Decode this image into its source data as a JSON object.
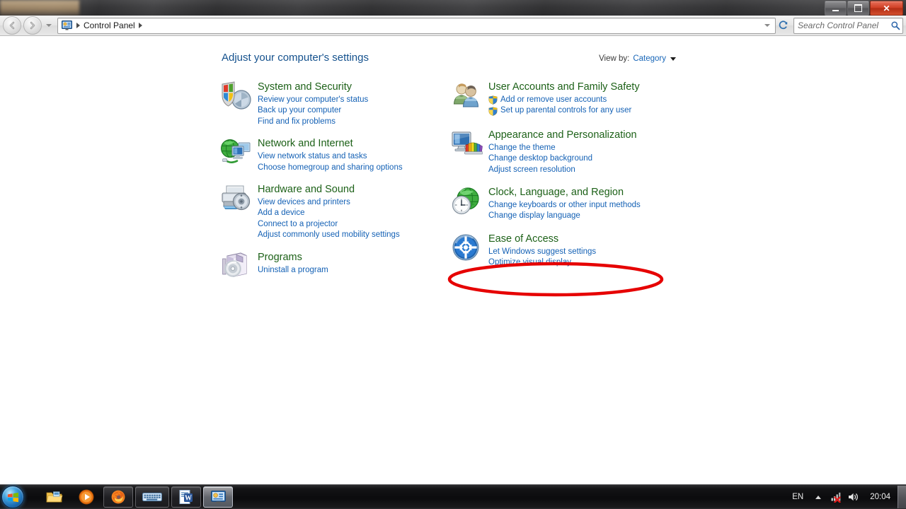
{
  "window": {
    "minimize_label": "Minimize",
    "maximize_label": "Maximize",
    "close_label": "Close"
  },
  "navbar": {
    "back_label": "Back",
    "forward_label": "Forward",
    "recent_pages_label": "Recent pages",
    "address_icon": "control-panel-icon",
    "breadcrumb": "Control Panel",
    "previous_locations_label": "Previous locations",
    "refresh_label": "Refresh",
    "search_placeholder": "Search Control Panel",
    "search_value": ""
  },
  "main": {
    "title": "Adjust your computer's settings",
    "view_by_label": "View by:",
    "view_by_value": "Category"
  },
  "categories": {
    "left": [
      {
        "icon": "security-shield-icon",
        "title": "System and Security",
        "links": [
          {
            "text": "Review your computer's status",
            "shield": false
          },
          {
            "text": "Back up your computer",
            "shield": false
          },
          {
            "text": "Find and fix problems",
            "shield": false
          }
        ]
      },
      {
        "icon": "network-globe-icon",
        "title": "Network and Internet",
        "links": [
          {
            "text": "View network status and tasks",
            "shield": false
          },
          {
            "text": "Choose homegroup and sharing options",
            "shield": false
          }
        ]
      },
      {
        "icon": "printer-sound-icon",
        "title": "Hardware and Sound",
        "links": [
          {
            "text": "View devices and printers",
            "shield": false
          },
          {
            "text": "Add a device",
            "shield": false
          },
          {
            "text": "Connect to a projector",
            "shield": false
          },
          {
            "text": "Adjust commonly used mobility settings",
            "shield": false
          }
        ]
      },
      {
        "icon": "programs-disc-icon",
        "title": "Programs",
        "links": [
          {
            "text": "Uninstall a program",
            "shield": false
          }
        ]
      }
    ],
    "right": [
      {
        "icon": "user-accounts-icon",
        "title": "User Accounts and Family Safety",
        "links": [
          {
            "text": "Add or remove user accounts",
            "shield": true
          },
          {
            "text": "Set up parental controls for any user",
            "shield": true
          }
        ]
      },
      {
        "icon": "appearance-monitor-icon",
        "title": "Appearance and Personalization",
        "links": [
          {
            "text": "Change the theme",
            "shield": false
          },
          {
            "text": "Change desktop background",
            "shield": false
          },
          {
            "text": "Adjust screen resolution",
            "shield": false
          }
        ]
      },
      {
        "icon": "clock-globe-icon",
        "title": "Clock, Language, and Region",
        "links": [
          {
            "text": "Change keyboards or other input methods",
            "shield": false
          },
          {
            "text": "Change display language",
            "shield": false
          }
        ]
      },
      {
        "icon": "ease-of-access-icon",
        "title": "Ease of Access",
        "links": [
          {
            "text": "Let Windows suggest settings",
            "shield": false
          },
          {
            "text": "Optimize visual display",
            "shield": false
          }
        ]
      }
    ]
  },
  "annotation": {
    "shape": "ellipse",
    "color": "#e60000",
    "target": "Clock, Language, and Region"
  },
  "taskbar": {
    "start_label": "Start",
    "buttons": [
      {
        "icon": "windows-explorer-icon",
        "state": "pinned"
      },
      {
        "icon": "media-player-icon",
        "state": "pinned"
      },
      {
        "icon": "firefox-icon",
        "state": "running"
      },
      {
        "icon": "on-screen-keyboard-icon",
        "state": "running"
      },
      {
        "icon": "word-icon",
        "state": "running"
      },
      {
        "icon": "control-panel-icon",
        "state": "active"
      }
    ],
    "tray": {
      "language": "EN",
      "show_hidden_label": "Show hidden icons",
      "network_icon": "network-disconnected-icon",
      "volume_icon": "speaker-icon",
      "clock": "20:04",
      "show_desktop_label": "Show desktop"
    }
  },
  "colors": {
    "category_title": "#1d6118",
    "link": "#1461b5",
    "page_title": "#14518d",
    "annotation": "#e60000"
  }
}
